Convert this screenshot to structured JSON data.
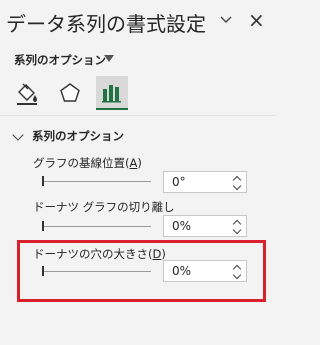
{
  "pane": {
    "title": "データ系列の書式設定",
    "close_glyph": "×"
  },
  "options_menu": {
    "label": "系列のオプション"
  },
  "tabs": [
    {
      "name": "fill-line",
      "icon": "paint-bucket-icon",
      "active": false
    },
    {
      "name": "effects",
      "icon": "pentagon-icon",
      "active": false
    },
    {
      "name": "series-options",
      "icon": "bar-chart-icon",
      "active": true
    }
  ],
  "section": {
    "title": "系列のオプション",
    "expanded": true
  },
  "fields": [
    {
      "label_pre": "グラフの基線位置(",
      "accel": "A",
      "label_post": ")",
      "value": "0°",
      "level": 0
    },
    {
      "label_pre": "ドーナツ グラフの切り離し",
      "accel": "",
      "label_post": "",
      "value": "0%",
      "level": 0
    },
    {
      "label_pre": "ドーナツの穴の大きさ(",
      "accel": "D",
      "label_post": ")",
      "value": "0%",
      "level": 0
    }
  ],
  "colors": {
    "highlight": "#d9202b",
    "active_tab": "#217346"
  }
}
